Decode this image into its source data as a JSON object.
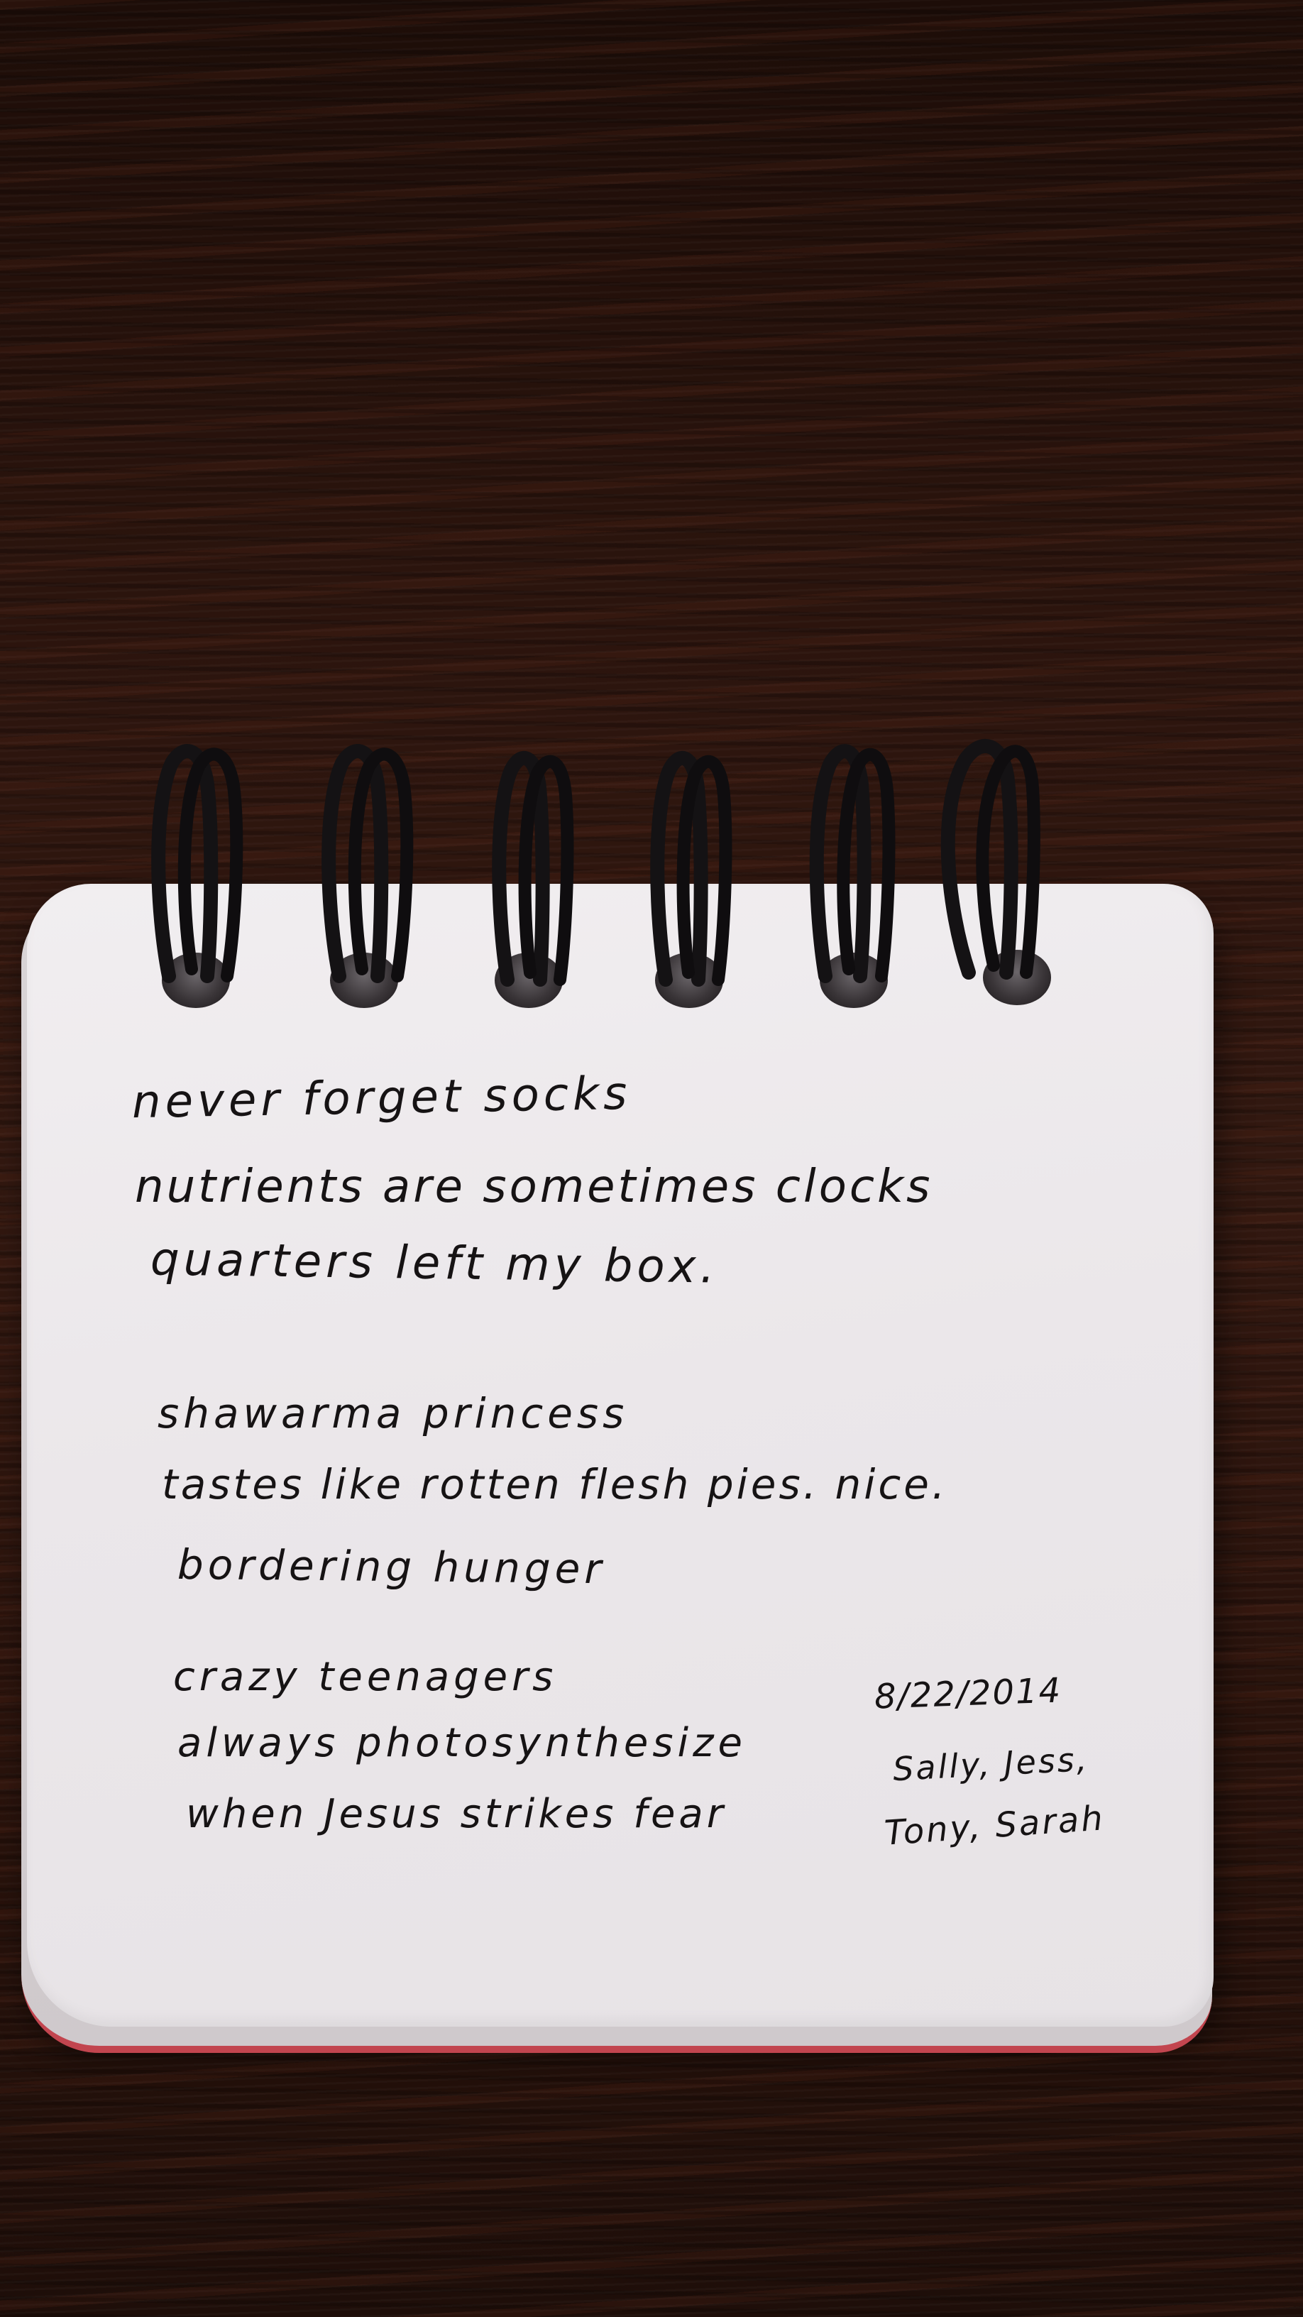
{
  "scene": {
    "surface": "dark wood tabletop",
    "object": "spiral-bound notepad",
    "colors": {
      "wood": "#2a120c",
      "paper": "#ece8eb",
      "ink": "#161314",
      "spiral": "#141214",
      "page_edge_accent": "#c2454f"
    },
    "icons": [
      "spiral-ring-icon",
      "punch-hole-icon"
    ]
  },
  "notepad": {
    "haikus": [
      {
        "lines": [
          "never forget socks",
          "nutrients are sometimes clocks",
          "quarters left my box."
        ]
      },
      {
        "lines": [
          "shawarma princess",
          "tastes like rotten flesh pies. nice.",
          "bordering hunger"
        ]
      },
      {
        "lines": [
          "crazy teenagers",
          "always photosynthesize",
          "when Jesus strikes fear"
        ]
      }
    ],
    "signoff": {
      "date": "8/22/2014",
      "names_line1": "Sally, Jess,",
      "names_line2": "Tony, Sarah"
    }
  }
}
